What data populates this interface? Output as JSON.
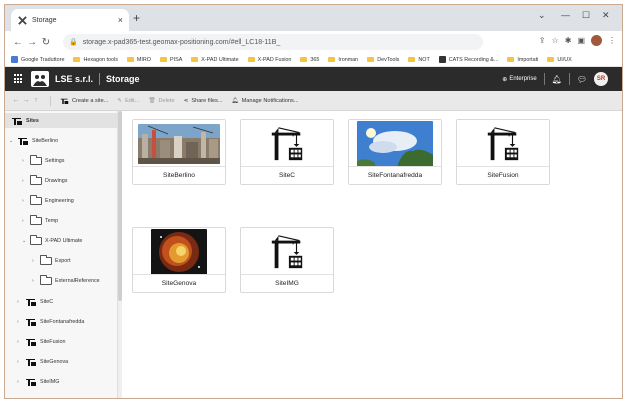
{
  "browser": {
    "tab_title": "Storage",
    "url": "storage.x-pad365-test.geomax-positioning.com/#ell_LC18-11B_",
    "bookmarks": [
      "Google Traduttore",
      "Hexagon tools",
      "MIRO",
      "PISA",
      "X-PAD Ultimate",
      "X-PAD Fusion",
      "365",
      "Ironman",
      "DevTools",
      "NOT",
      "CATS Recording &...",
      "Importati",
      "UI/UX"
    ]
  },
  "header": {
    "company": "LSE s.r.l.",
    "app_name": "Storage",
    "enterprise_label": "Enterprise",
    "user_initials": "SR"
  },
  "toolbar": {
    "create_site": "Create a site...",
    "edit": "Edit...",
    "delete": "Delete",
    "share_files": "Share files...",
    "manage_notifications": "Manage Notifications..."
  },
  "sidebar": {
    "root": "Sites",
    "items": [
      {
        "label": "SiteBerlino"
      },
      {
        "label": "Settings"
      },
      {
        "label": "Drawings"
      },
      {
        "label": "Engineering"
      },
      {
        "label": "Temp"
      },
      {
        "label": "X-PAD Ultimate"
      },
      {
        "label": "Export"
      },
      {
        "label": "ExternalReference"
      },
      {
        "label": "SiteC"
      },
      {
        "label": "SiteFontanafredda"
      },
      {
        "label": "SiteFusion"
      },
      {
        "label": "SiteGenova"
      },
      {
        "label": "SiteIMG"
      }
    ]
  },
  "sites": [
    {
      "name": "SiteBerlino",
      "thumb": "photo-city"
    },
    {
      "name": "SiteC",
      "thumb": "crane-icon"
    },
    {
      "name": "SiteFontanafredda",
      "thumb": "photo-sky"
    },
    {
      "name": "SiteFusion",
      "thumb": "crane-icon"
    },
    {
      "name": "SiteGenova",
      "thumb": "photo-nebula"
    },
    {
      "name": "SiteIMG",
      "thumb": "crane-icon"
    }
  ],
  "colors": {
    "header_bg": "#2b2b2b",
    "toolbar_bg": "#e9e9e9",
    "avatar_text": "#c0392b"
  }
}
